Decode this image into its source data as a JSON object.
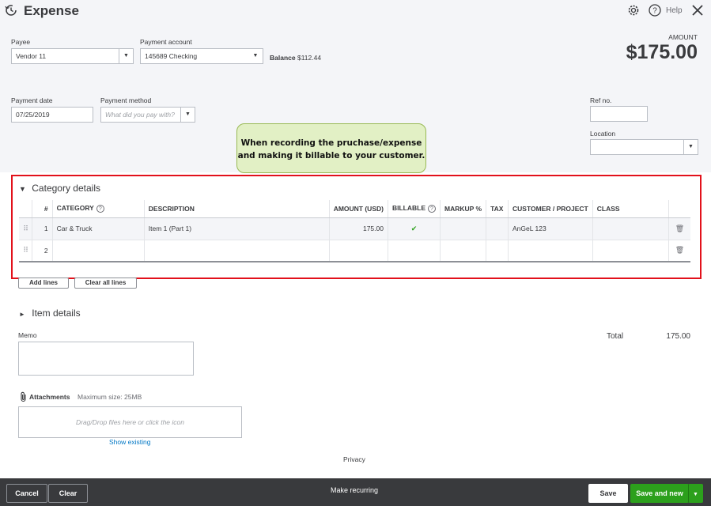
{
  "header": {
    "title": "Expense",
    "help_label": "Help",
    "amount_label": "AMOUNT",
    "amount_value": "$175.00"
  },
  "form": {
    "payee_label": "Payee",
    "payee_value": "Vendor 11",
    "payment_account_label": "Payment account",
    "payment_account_value": "145689 Checking",
    "balance_label": "Balance",
    "balance_value": "$112.44",
    "payment_date_label": "Payment date",
    "payment_date_value": "07/25/2019",
    "payment_method_label": "Payment method",
    "payment_method_placeholder": "What did you pay with?",
    "ref_no_label": "Ref no.",
    "ref_no_value": "",
    "location_label": "Location",
    "location_value": ""
  },
  "callout": {
    "line1": "When recording the pruchase/expense",
    "line2": "and making it billable to your customer."
  },
  "category_details": {
    "toggle": "▼",
    "title": "Category details",
    "columns": [
      "#",
      "CATEGORY",
      "DESCRIPTION",
      "AMOUNT (USD)",
      "BILLABLE",
      "MARKUP %",
      "TAX",
      "CUSTOMER / PROJECT",
      "CLASS"
    ],
    "rows": [
      {
        "num": "1",
        "category": "Car & Truck",
        "description": "Item 1 (Part 1)",
        "amount": "175.00",
        "billable": "✔",
        "markup": "",
        "tax": "",
        "customer": "AnGeL 123",
        "class": ""
      },
      {
        "num": "2",
        "category": "",
        "description": "",
        "amount": "",
        "billable": "",
        "markup": "",
        "tax": "",
        "customer": "",
        "class": ""
      }
    ],
    "add_lines": "Add lines",
    "clear_all_lines": "Clear all lines"
  },
  "item_details": {
    "toggle": "►",
    "title": "Item details"
  },
  "memo_label": "Memo",
  "total": {
    "label": "Total",
    "value": "175.00"
  },
  "attachments": {
    "label": "Attachments",
    "max_size": "Maximum size: 25MB",
    "dropzone": "Drag/Drop files here or click the icon",
    "show_existing": "Show existing"
  },
  "privacy": "Privacy",
  "footer": {
    "cancel": "Cancel",
    "clear": "Clear",
    "make_recurring": "Make recurring",
    "save": "Save",
    "save_and_new": "Save and new"
  },
  "icons": {
    "history": "history-icon",
    "settings": "gear-icon",
    "help": "help-icon",
    "close": "close-icon",
    "drag": "drag-handle-icon",
    "delete": "trash-icon",
    "paperclip": "paperclip-icon"
  },
  "colors": {
    "accent_green": "#2ca01c",
    "highlight_red": "#e2111b",
    "callout_bg": "#e2f0c5",
    "link_blue": "#0077c5"
  }
}
